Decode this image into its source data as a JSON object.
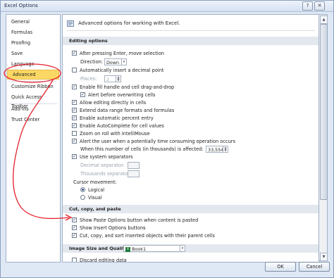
{
  "window": {
    "title": "Excel Options",
    "help_glyph": "?",
    "close_glyph": "✕"
  },
  "sidebar": {
    "items": [
      {
        "label": "General"
      },
      {
        "label": "Formulas"
      },
      {
        "label": "Proofing"
      },
      {
        "label": "Save"
      },
      {
        "label": "Language"
      },
      {
        "label": "Advanced"
      },
      {
        "label": "Customize Ribbon"
      },
      {
        "label": "Quick Access Toolbar"
      },
      {
        "label": "Add-Ins"
      },
      {
        "label": "Trust Center"
      }
    ],
    "selected": "Advanced"
  },
  "header": {
    "text": "Advanced options for working with Excel."
  },
  "editing": {
    "title": "Editing options",
    "after_enter": "After pressing Enter, move selection",
    "direction_label": "Direction:",
    "direction_value": "Down",
    "auto_decimal": "Automatically insert a decimal point",
    "places_label": "Places:",
    "places_value": "2",
    "fill_handle": "Enable fill handle and cell drag-and-drop",
    "alert_overwrite": "Alert before overwriting cells",
    "allow_editing": "Allow editing directly in cells",
    "extend_formats": "Extend data range formats and formulas",
    "auto_percent": "Enable automatic percent entry",
    "autocomplete": "Enable AutoComplete for cell values",
    "zoom_roll": "Zoom on roll with IntelliMouse",
    "alert_time": "Alert the user when a potentially time consuming operation occurs",
    "cells_label": "When this number of cells (in thousands) is affected:",
    "cells_value": "33,554",
    "system_sep": "Use system separators",
    "decimal_sep": "Decimal separator:",
    "thousands_sep": "Thousands separator:",
    "cursor_movement": "Cursor movement:",
    "logical": "Logical",
    "visual": "Visual"
  },
  "ccp": {
    "title": "Cut, copy, and paste",
    "paste_options": "Show Paste Options button when content is pasted",
    "insert_options": "Show Insert Options buttons",
    "cut_copy_sort": "Cut, copy, and sort inserted objects with their parent cells"
  },
  "image_quality": {
    "title": "Image Size and Quality",
    "workbook": "Book1",
    "discard": "Discard editing data"
  },
  "buttons": {
    "ok": "OK",
    "cancel": "Cancel"
  },
  "colors": {
    "selected": "#fbd864",
    "annotation": "#e4202a",
    "section": "#e3e8ef"
  }
}
